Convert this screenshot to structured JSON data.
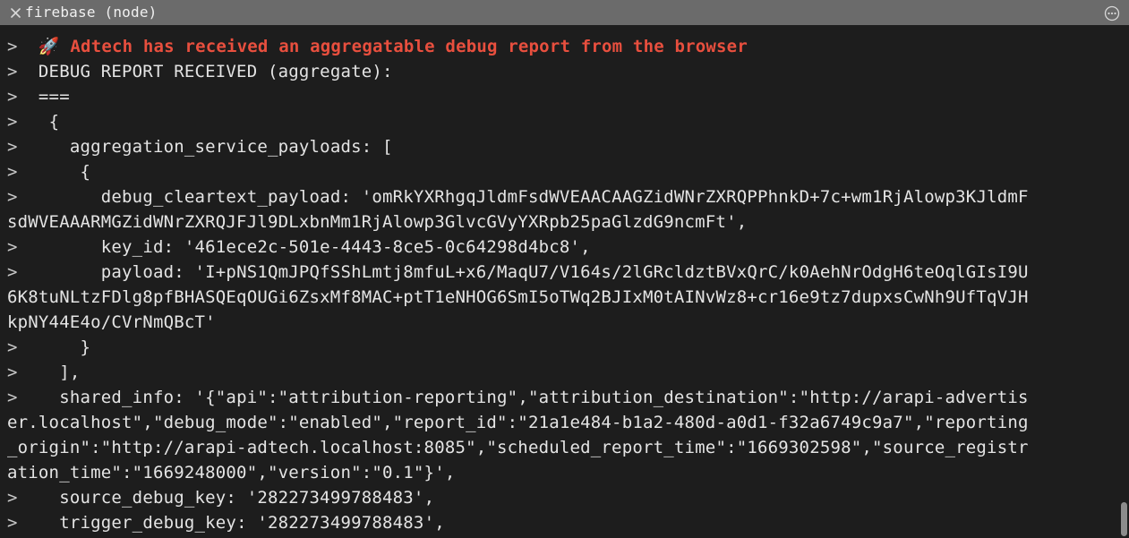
{
  "tab": {
    "title": "firebase (node)"
  },
  "prompt": ">",
  "indent2": "  ",
  "indent3": "   ",
  "indent4": "    ",
  "indent5": "     ",
  "indent6": "      ",
  "indent8": "        ",
  "rocket": "🚀",
  "space": " ",
  "highlight": "Adtech has received an aggregatable debug report from the browser",
  "lines": {
    "l2": "DEBUG REPORT RECEIVED (aggregate):",
    "l3": "===",
    "l4": "{",
    "l5": "aggregation_service_payloads: [",
    "l6": "{",
    "l7a": "debug_cleartext_payload: 'omRkYXRhgqJldmFsdWVEAACAAGZidWNrZXRQPPhnkD+7c+wm1RjAlowp3KJldmF",
    "l7b": "sdWVEAAARMGZidWNrZXRQJFJl9DLxbnMm1RjAlowp3GlvcGVyYXRpb25paGlzdG9ncmFt',",
    "l8": "key_id: '461ece2c-501e-4443-8ce5-0c64298d4bc8',",
    "l9a": "payload: 'I+pNS1QmJPQfSShLmtj8mfuL+x6/MaqU7/V164s/2lGRcldztBVxQrC/k0AehNrOdgH6teOqlGIsI9U",
    "l9b": "6K8tuNLtzFDlg8pfBHASQEqOUGi6ZsxMf8MAC+ptT1eNHOG6SmI5oTWq2BJIxM0tAINvWz8+cr16e9tz7dupxsCwNh9UfTqVJH",
    "l9c": "kpNY44E4o/CVrNmQBcT'",
    "l10": "}",
    "l11": "],",
    "l12a": "shared_info: '{\"api\":\"attribution-reporting\",\"attribution_destination\":\"http://arapi-advertis",
    "l12b": "er.localhost\",\"debug_mode\":\"enabled\",\"report_id\":\"21a1e484-b1a2-480d-a0d1-f32a6749c9a7\",\"reporting",
    "l12c": "_origin\":\"http://arapi-adtech.localhost:8085\",\"scheduled_report_time\":\"1669302598\",\"source_registr",
    "l12d": "ation_time\":\"1669248000\",\"version\":\"0.1\"}',",
    "l13": "source_debug_key: '282273499788483',",
    "l14": "trigger_debug_key: '282273499788483',"
  }
}
